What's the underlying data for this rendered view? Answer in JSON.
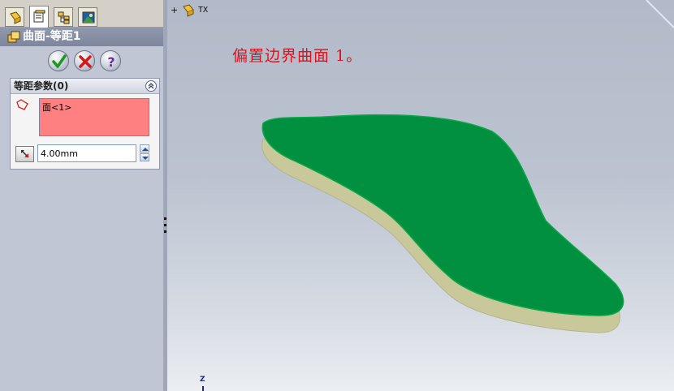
{
  "property_manager": {
    "tabs": [
      {
        "name": "feature-manager"
      },
      {
        "name": "property-manager"
      },
      {
        "name": "configuration-manager"
      },
      {
        "name": "display-manager"
      }
    ],
    "title": "曲面-等距1",
    "actions": {
      "ok_icon": "check-icon",
      "cancel_icon": "x-icon",
      "help_icon": "question-icon"
    },
    "group": {
      "label": "等距参数(0)",
      "faces": [
        "面<1>"
      ],
      "distance": "4.00mm"
    }
  },
  "viewport": {
    "part_name": "TX",
    "annotation": "偏置边界曲面 1。",
    "triad_label": "Z"
  },
  "colors": {
    "offset_surface": "#00903f",
    "base_surface": "#c8c89a",
    "annotation": "#e0101c",
    "face_selection": "#ff8080"
  }
}
